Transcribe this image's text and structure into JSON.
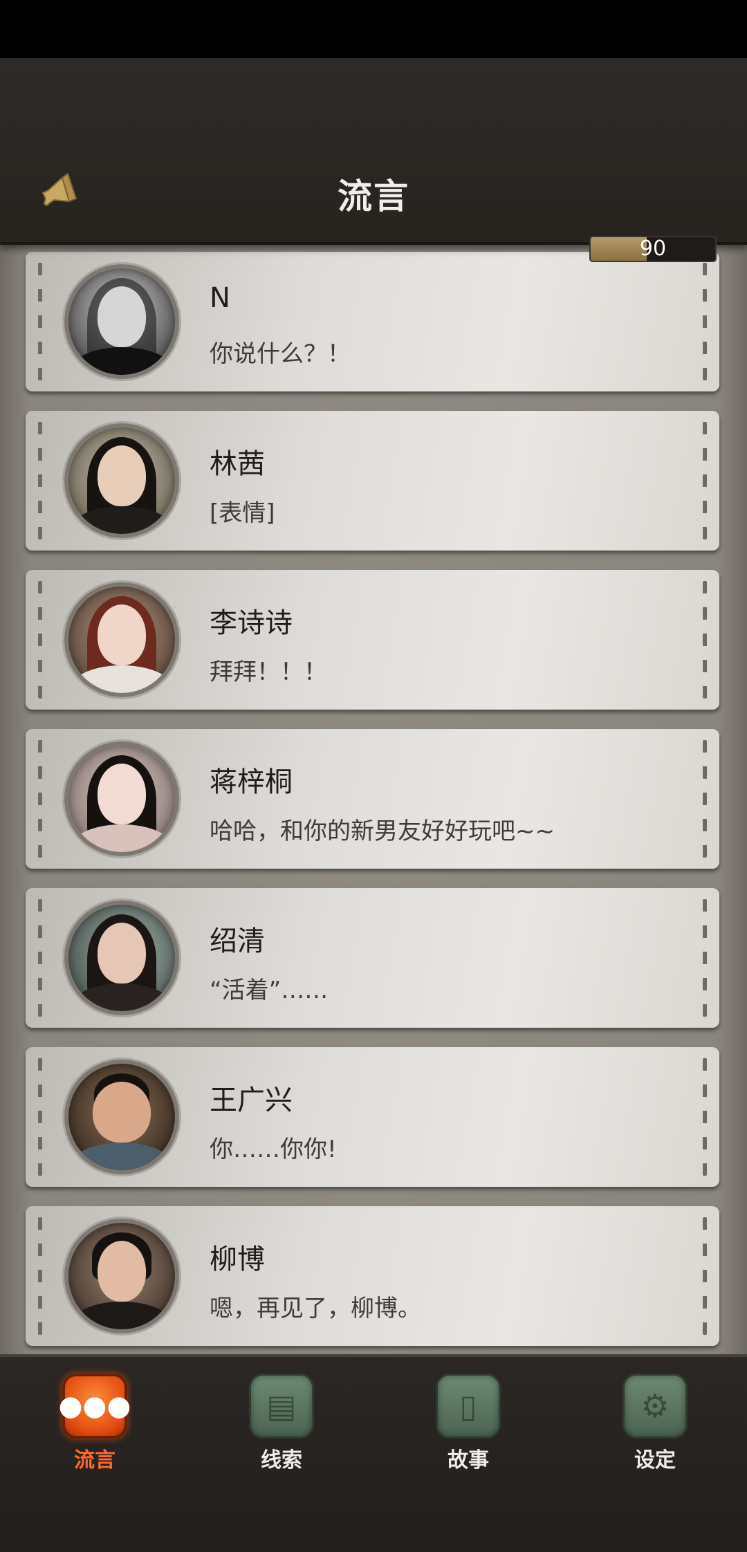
{
  "header": {
    "title": "流言",
    "meter_value": "90",
    "meter_fraction": 0.45
  },
  "contacts": [
    {
      "name": "N",
      "message": "你说什么？！"
    },
    {
      "name": "林茜",
      "message": "[表情]"
    },
    {
      "name": "李诗诗",
      "message": "拜拜！！！"
    },
    {
      "name": "蒋梓桐",
      "message": "哈哈，和你的新男友好好玩吧~~"
    },
    {
      "name": "绍清",
      "message": "“活着”……"
    },
    {
      "name": "王广兴",
      "message": "你……你你!"
    },
    {
      "name": "柳博",
      "message": "嗯，再见了，柳博。"
    }
  ],
  "nav": {
    "items": [
      {
        "label": "流言",
        "icon": "chat-bubble-icon",
        "active": true
      },
      {
        "label": "线索",
        "icon": "document-icon",
        "active": false
      },
      {
        "label": "故事",
        "icon": "book-icon",
        "active": false
      },
      {
        "label": "设定",
        "icon": "gear-icon",
        "active": false
      }
    ]
  },
  "colors": {
    "accent_active": "#e24c10",
    "meter_fill": "#8b7043",
    "nav_icon_bg": "#4b6451"
  }
}
